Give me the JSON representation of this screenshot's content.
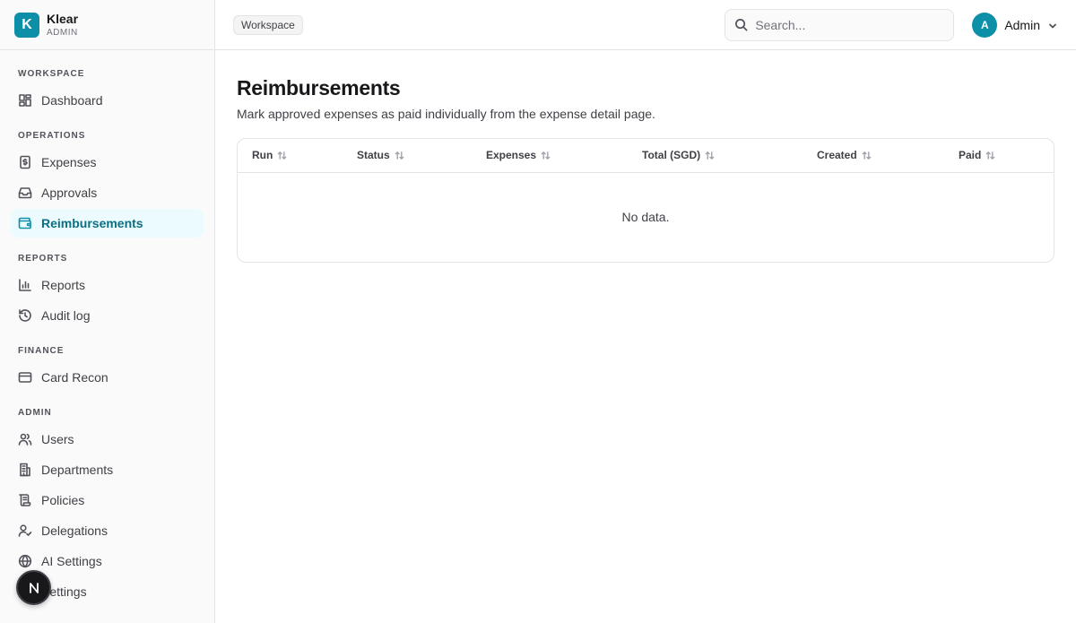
{
  "brand": {
    "logo_letter": "K",
    "name": "Klear",
    "subtitle": "ADMIN",
    "color": "#0e8fa8"
  },
  "sidebar": {
    "groups": [
      {
        "label": "WORKSPACE",
        "items": [
          {
            "label": "Dashboard",
            "icon": "dashboard-icon"
          }
        ]
      },
      {
        "label": "OPERATIONS",
        "items": [
          {
            "label": "Expenses",
            "icon": "receipt-icon"
          },
          {
            "label": "Approvals",
            "icon": "inbox-icon"
          },
          {
            "label": "Reimbursements",
            "icon": "wallet-icon",
            "active": true
          }
        ]
      },
      {
        "label": "REPORTS",
        "items": [
          {
            "label": "Reports",
            "icon": "bar-chart-icon"
          },
          {
            "label": "Audit log",
            "icon": "history-icon"
          }
        ]
      },
      {
        "label": "FINANCE",
        "items": [
          {
            "label": "Card Recon",
            "icon": "credit-card-icon"
          }
        ]
      },
      {
        "label": "ADMIN",
        "items": [
          {
            "label": "Users",
            "icon": "users-icon"
          },
          {
            "label": "Departments",
            "icon": "building-icon"
          },
          {
            "label": "Policies",
            "icon": "scroll-icon"
          },
          {
            "label": "Delegations",
            "icon": "user-check-icon"
          },
          {
            "label": "AI Settings",
            "icon": "globe-icon"
          },
          {
            "label": "Settings",
            "icon": "gear-icon"
          }
        ]
      }
    ],
    "fab_letter": "N"
  },
  "topbar": {
    "workspace_badge": "Workspace",
    "search_placeholder": "Search...",
    "search_value": "",
    "user": {
      "initial": "A",
      "name": "Admin"
    }
  },
  "page": {
    "title": "Reimbursements",
    "description": "Mark approved expenses as paid individually from the expense detail page."
  },
  "table": {
    "columns": [
      "Run",
      "Status",
      "Expenses",
      "Total (SGD)",
      "Created",
      "Paid"
    ],
    "empty_text": "No data."
  },
  "colors": {
    "accent": "#0e8fa8",
    "active_bg": "#ecfcfe",
    "active_text": "#0b6e82"
  }
}
